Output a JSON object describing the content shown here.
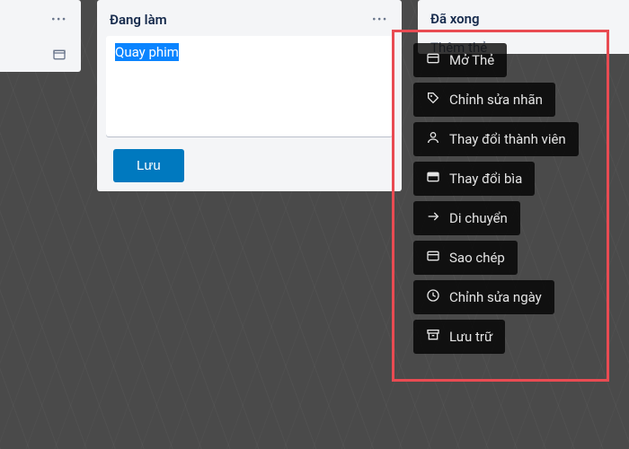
{
  "columns": {
    "left_title": "",
    "middle_title": "Đang làm",
    "right_title": "Đã xong",
    "right_add_card": "Thêm thẻ"
  },
  "edit": {
    "card_text": "Quay phim",
    "save_label": "Lưu"
  },
  "context_menu": [
    {
      "key": "open-card",
      "label": "Mở Thẻ",
      "icon": "card"
    },
    {
      "key": "edit-labels",
      "label": "Chỉnh sửa nhãn",
      "icon": "tag"
    },
    {
      "key": "change-members",
      "label": "Thay đổi thành viên",
      "icon": "user"
    },
    {
      "key": "change-cover",
      "label": "Thay đổi bìa",
      "icon": "cover"
    },
    {
      "key": "move",
      "label": "Di chuyển",
      "icon": "arrow"
    },
    {
      "key": "copy",
      "label": "Sao chép",
      "icon": "card"
    },
    {
      "key": "edit-dates",
      "label": "Chỉnh sửa ngày",
      "icon": "clock"
    },
    {
      "key": "archive",
      "label": "Lưu trữ",
      "icon": "archive"
    }
  ]
}
